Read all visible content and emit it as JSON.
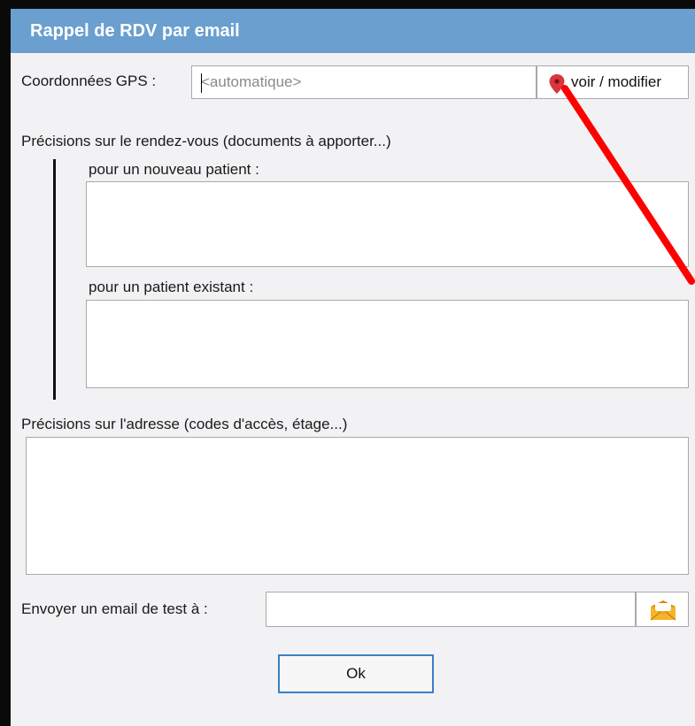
{
  "dialog": {
    "title": "Rappel de RDV par email",
    "title_bar_color": "#6a9fcf"
  },
  "gps": {
    "label": "Coordonnées GPS :",
    "placeholder": "<automatique>",
    "button_label": "voir / modifier",
    "button_icon": "map-pin-icon",
    "pin_color": "#d9363e"
  },
  "appointment": {
    "section_label": "Précisions sur le rendez-vous (documents à apporter...)",
    "new_patient_label": "pour un nouveau patient :",
    "new_patient_value": "",
    "existing_patient_label": "pour un patient existant :",
    "existing_patient_value": ""
  },
  "address": {
    "label": "Précisions sur l'adresse (codes d'accès, étage...)",
    "value": ""
  },
  "test_email": {
    "label": "Envoyer un email de test à :",
    "value": "",
    "button_icon": "envelope-icon",
    "icon_color": "#f0a81e"
  },
  "actions": {
    "ok_label": "Ok",
    "ok_border_color": "#3a7fc8"
  },
  "annotation": {
    "arrow_color": "#ff0000"
  }
}
